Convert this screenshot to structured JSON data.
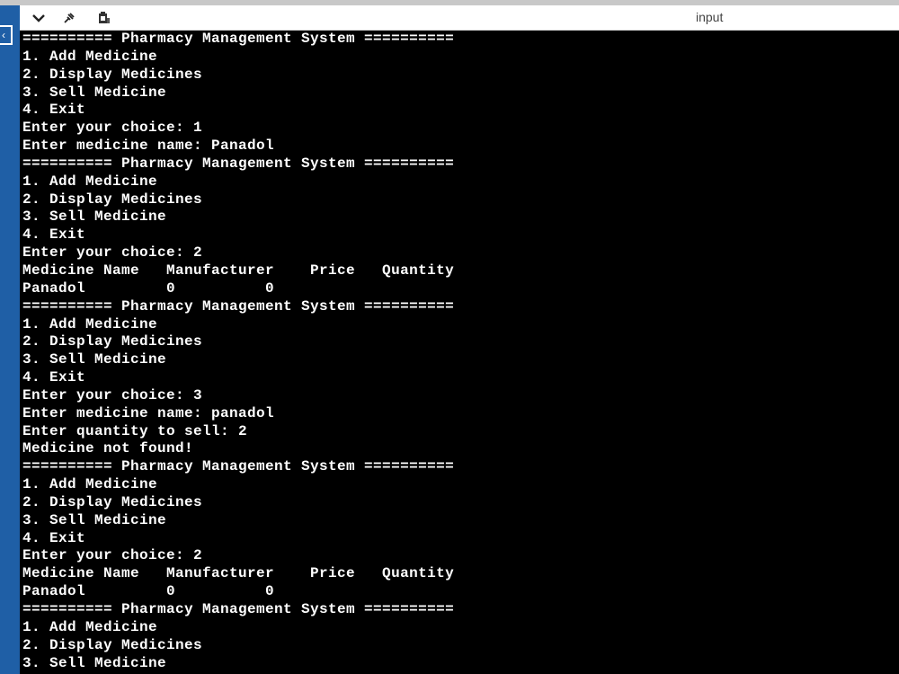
{
  "toolbar": {
    "icons": [
      "chevron-down-icon",
      "pin-icon",
      "clipboard-icon"
    ],
    "input_label": "input"
  },
  "colors": {
    "terminal_bg": "#000000",
    "terminal_text": "#ffffff",
    "left_bar": "#1f5fa6"
  },
  "console": {
    "lines": [
      "========== Pharmacy Management System ==========",
      "1. Add Medicine",
      "2. Display Medicines",
      "3. Sell Medicine",
      "4. Exit",
      "Enter your choice: 1",
      "Enter medicine name: Panadol",
      "========== Pharmacy Management System ==========",
      "1. Add Medicine",
      "2. Display Medicines",
      "3. Sell Medicine",
      "4. Exit",
      "Enter your choice: 2",
      "Medicine Name   Manufacturer    Price   Quantity",
      "Panadol         0          0",
      "========== Pharmacy Management System ==========",
      "1. Add Medicine",
      "2. Display Medicines",
      "3. Sell Medicine",
      "4. Exit",
      "Enter your choice: 3",
      "Enter medicine name: panadol",
      "Enter quantity to sell: 2",
      "Medicine not found!",
      "========== Pharmacy Management System ==========",
      "1. Add Medicine",
      "2. Display Medicines",
      "3. Sell Medicine",
      "4. Exit",
      "Enter your choice: 2",
      "Medicine Name   Manufacturer    Price   Quantity",
      "Panadol         0          0",
      "========== Pharmacy Management System ==========",
      "1. Add Medicine",
      "2. Display Medicines",
      "3. Sell Medicine"
    ]
  }
}
